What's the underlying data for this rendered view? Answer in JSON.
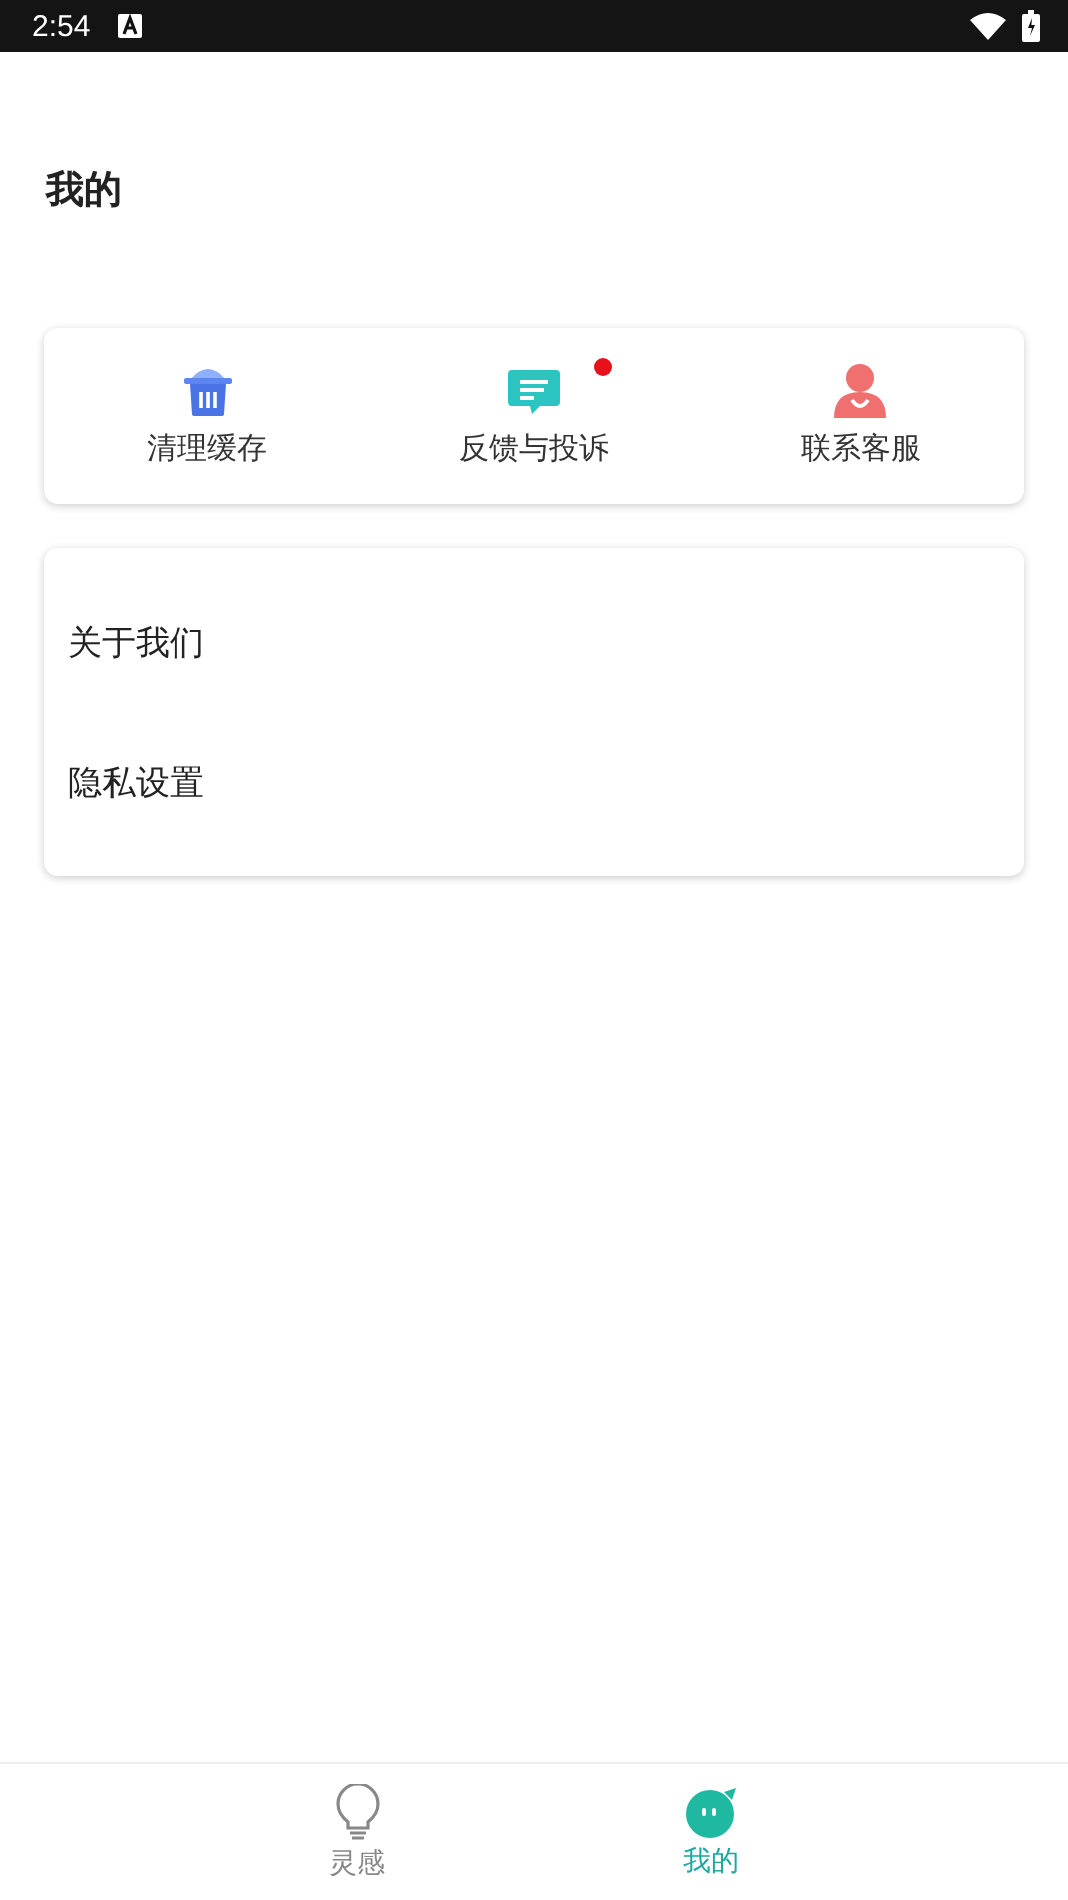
{
  "status_bar": {
    "time": "2:54"
  },
  "page_title": "我的",
  "quick_actions": [
    {
      "kind": "trash",
      "label": "清理缓存",
      "badge": false
    },
    {
      "kind": "chat",
      "label": "反馈与投诉",
      "badge": true
    },
    {
      "kind": "person",
      "label": "联系客服",
      "badge": false
    }
  ],
  "menu_items": [
    {
      "label": "关于我们"
    },
    {
      "label": "隐私设置"
    }
  ],
  "bottom_nav": [
    {
      "kind": "bulb",
      "label": "灵感",
      "selected": false
    },
    {
      "kind": "face",
      "label": "我的",
      "selected": true
    }
  ]
}
